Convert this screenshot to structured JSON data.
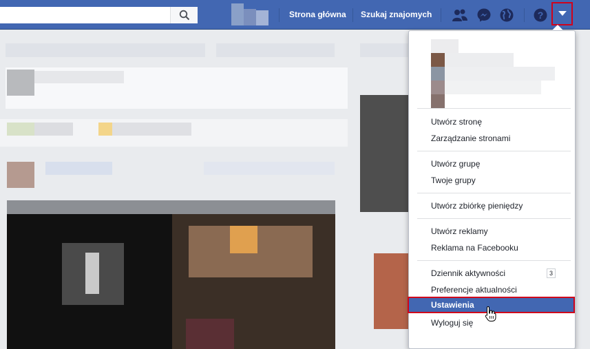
{
  "header": {
    "nav_home": "Strona główna",
    "nav_find_friends": "Szukaj znajomych"
  },
  "menu": {
    "groups": [
      [
        "Utwórz stronę",
        "Zarządzanie stronami"
      ],
      [
        "Utwórz grupę",
        "Twoje grupy"
      ],
      [
        "Utwórz zbiórkę pieniędzy"
      ],
      [
        "Utwórz reklamy",
        "Reklama na Facebooku"
      ],
      [
        "Dziennik aktywności",
        "Preferencje aktualności",
        "Ustawienia",
        "Wyloguj się"
      ]
    ],
    "activity_badge": "3",
    "selected": "Ustawienia"
  },
  "colors": {
    "topbar": "#4267b2",
    "highlight": "#d0021b",
    "menu_active": "#4267b2"
  },
  "icons": [
    "search-icon",
    "friends-icon",
    "messenger-icon",
    "globe-icon",
    "help-icon",
    "caret-down-icon"
  ]
}
